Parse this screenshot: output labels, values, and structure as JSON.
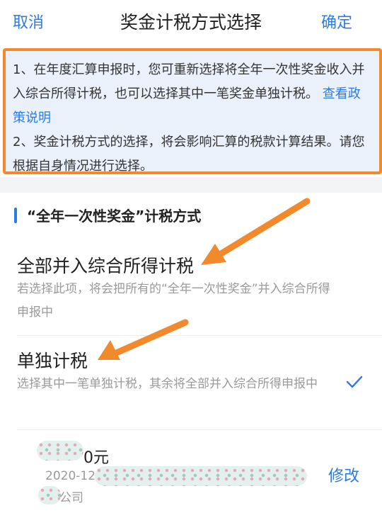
{
  "nav": {
    "cancel_label": "取消",
    "title": "奖金计税方式选择",
    "confirm_label": "确定"
  },
  "notice": {
    "line1_pre": "1、在年度汇算申报时，您可重新选择将全年一次性奖金收入并入综合所得计税，也可以选择其中一笔奖金单独计税。",
    "policy_link": "查看政策说明",
    "line2": "2、奖金计税方式的选择，将会影响汇算的税款计算结果。请您根据自身情况进行选择。"
  },
  "section": {
    "title": "“全年一次性奖金”计税方式"
  },
  "options": [
    {
      "title": "全部并入综合所得计税",
      "description": "若选择此项，将会把所有的“全年一次性奖金”并入综合所得申报中",
      "selected": false
    },
    {
      "title": "单独计税",
      "description": "选择其中一笔单独计税，其余将全部并入综合所得申报中",
      "selected": true
    }
  ],
  "record": {
    "amount_suffix": "0元",
    "date_prefix": "2020-12",
    "company_suffix": "公司",
    "edit_label": "修改"
  },
  "colors": {
    "accent": "#2c7be5",
    "highlight": "#f08a2c",
    "notice_bg": "#eaf1fb"
  },
  "icons": {
    "selected": "checkmark-icon"
  }
}
